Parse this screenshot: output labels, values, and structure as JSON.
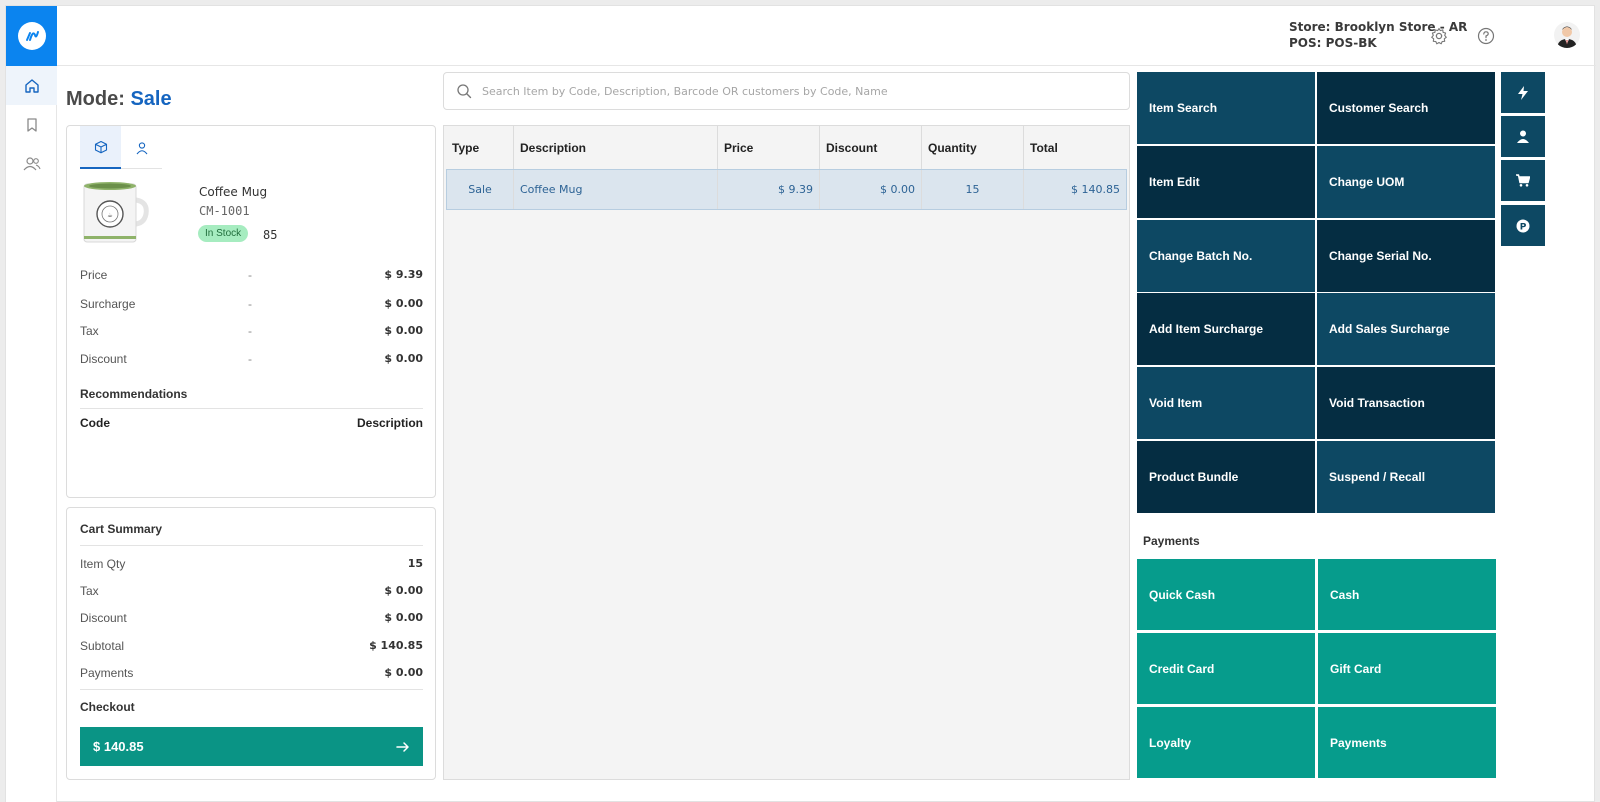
{
  "header": {
    "store": "Store: Brooklyn Store - AR",
    "pos": "POS: POS-BK"
  },
  "mode": {
    "label": "Mode:",
    "value": "Sale"
  },
  "product": {
    "name": "Coffee Mug",
    "code": "CM-1001",
    "stock_status": "In Stock",
    "stock_qty": "85",
    "details": [
      {
        "label": "Price",
        "dash": "-",
        "value": "$ 9.39"
      },
      {
        "label": "Surcharge",
        "dash": "-",
        "value": "$ 0.00"
      },
      {
        "label": "Tax",
        "dash": "-",
        "value": "$ 0.00"
      },
      {
        "label": "Discount",
        "dash": "-",
        "value": "$ 0.00"
      }
    ],
    "recommendations_title": "Recommendations",
    "rec_col_code": "Code",
    "rec_col_desc": "Description"
  },
  "cart": {
    "title": "Cart Summary",
    "rows": [
      {
        "label": "Item Qty",
        "value": "15"
      },
      {
        "label": "Tax",
        "value": "$ 0.00"
      },
      {
        "label": "Discount",
        "value": "$ 0.00"
      },
      {
        "label": "Subtotal",
        "value": "$ 140.85"
      },
      {
        "label": "Payments",
        "value": "$ 0.00"
      }
    ],
    "checkout_title": "Checkout",
    "checkout_amount": "$ 140.85"
  },
  "search": {
    "placeholder": "Search Item by Code, Description, Barcode OR customers by Code, Name"
  },
  "grid": {
    "columns": [
      "Type",
      "Description",
      "Price",
      "Discount",
      "Quantity",
      "Total"
    ],
    "rows": [
      {
        "type": "Sale",
        "description": "Coffee Mug",
        "price": "$ 9.39",
        "discount": "$ 0.00",
        "quantity": "15",
        "total": "$ 140.85"
      }
    ]
  },
  "actions": [
    "Item Search",
    "Customer Search",
    "Item Edit",
    "Change UOM",
    "Change Batch No.",
    "Change Serial No.",
    "Add Item Surcharge",
    "Add Sales Surcharge",
    "Void Item",
    "Void Transaction",
    "Product Bundle",
    "Suspend / Recall"
  ],
  "payments": {
    "title": "Payments",
    "buttons": [
      "Quick Cash",
      "Cash",
      "Credit Card",
      "Gift Card",
      "Loyalty",
      "Payments"
    ]
  },
  "colors": {
    "brand": "#0b84ef",
    "action_dark": "#052d42",
    "action_mid": "#0d4863",
    "payment": "#069c8c",
    "checkout": "#0a9485",
    "mode_accent": "#1565c0"
  },
  "icons": {
    "sidebar": [
      "home-icon",
      "bookmark-icon",
      "users-icon"
    ],
    "header": [
      "gear-icon",
      "help-icon",
      "avatar"
    ],
    "quick": [
      "lightning-icon",
      "user-icon",
      "cart-icon",
      "parking-icon"
    ]
  }
}
